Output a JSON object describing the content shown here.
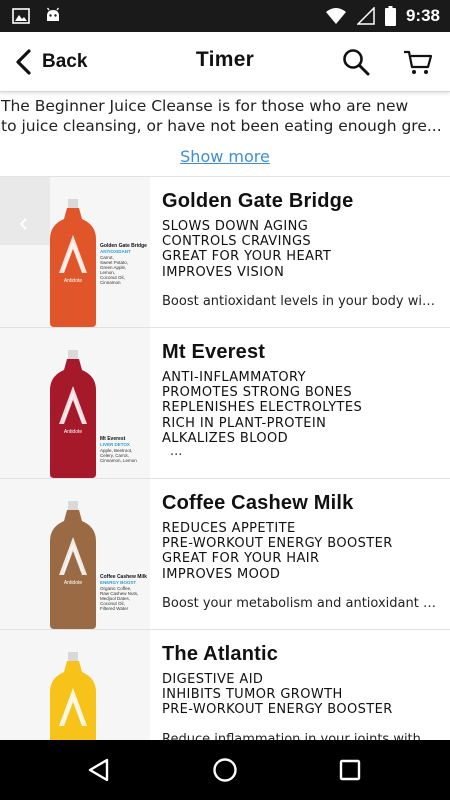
{
  "status_bar": {
    "time": "9:38"
  },
  "app_bar": {
    "back_label": "Back",
    "title": "Timer"
  },
  "description": {
    "line1": "The Beginner Juice Cleanse is for those who are new",
    "line2": "to juice cleansing, or have not been eating enough gre...",
    "show_more": "Show more"
  },
  "products": [
    {
      "name": "Golden Gate Bridge",
      "benefits": [
        "SLOWS DOWN AGING",
        "CONTROLS CRAVINGS",
        "GREAT FOR YOUR HEART",
        "IMPROVES VISION"
      ],
      "description": "Boost antioxidant levels in your body with...",
      "label": {
        "name": "Golden Gate Bridge",
        "category": "ANTIOXIDANT",
        "ingredients": [
          "Carrot,",
          "Sweet Potato,",
          "Green Apple,",
          "Lemon,",
          "Coconut Oil,",
          "Cinnamon"
        ]
      },
      "color": "#e0552a"
    },
    {
      "name": "Mt Everest",
      "benefits": [
        "ANTI-INFLAMMATORY",
        "PROMOTES STRONG BONES",
        "REPLENISHES ELECTROLYTES",
        "RICH IN PLANT-PROTEIN",
        "ALKALIZES BLOOD"
      ],
      "more": "...",
      "label": {
        "name": "Mt Everest",
        "category": "LIVER DETOX",
        "ingredients": [
          "Apple, Beetroot,",
          "Celery, Carrot,",
          "Cinnamon, Lemon"
        ]
      },
      "color": "#a5192b"
    },
    {
      "name": "Coffee Cashew Milk",
      "benefits": [
        "REDUCES APPETITE",
        "PRE-WORKOUT ENERGY BOOSTER",
        "GREAT FOR YOUR HAIR",
        "IMPROVES MOOD"
      ],
      "description": "Boost your metabolism and antioxidant le...",
      "label": {
        "name": "Coffee Cashew Milk",
        "category": "ENERGY BOOST",
        "ingredients": [
          "Organic Coffee,",
          "Raw Cashew Nuts,",
          "Medjool Dates,",
          "Coconut Oil,",
          "Filtered Water"
        ]
      },
      "color": "#9a6a45"
    },
    {
      "name": "The Atlantic",
      "benefits": [
        "DIGESTIVE AID",
        "INHIBITS TUMOR GROWTH",
        "PRE-WORKOUT ENERGY BOOSTER"
      ],
      "description": "Reduce inflammation in your joints with...",
      "color": "#f7c21a"
    }
  ],
  "colors": {
    "link": "#3c8ed6",
    "label_category": "#2f9fd6",
    "status_bar": "#1a1a1a",
    "nav_bar": "#000000"
  },
  "icons": {
    "status_left": [
      "image-icon",
      "android-icon"
    ],
    "status_right": [
      "wifi-icon",
      "signal-icon",
      "battery-icon"
    ],
    "app_bar": [
      "back-chevron-icon",
      "search-icon",
      "cart-icon"
    ],
    "nav": [
      "back-triangle-icon",
      "home-circle-icon",
      "recents-square-icon"
    ]
  }
}
